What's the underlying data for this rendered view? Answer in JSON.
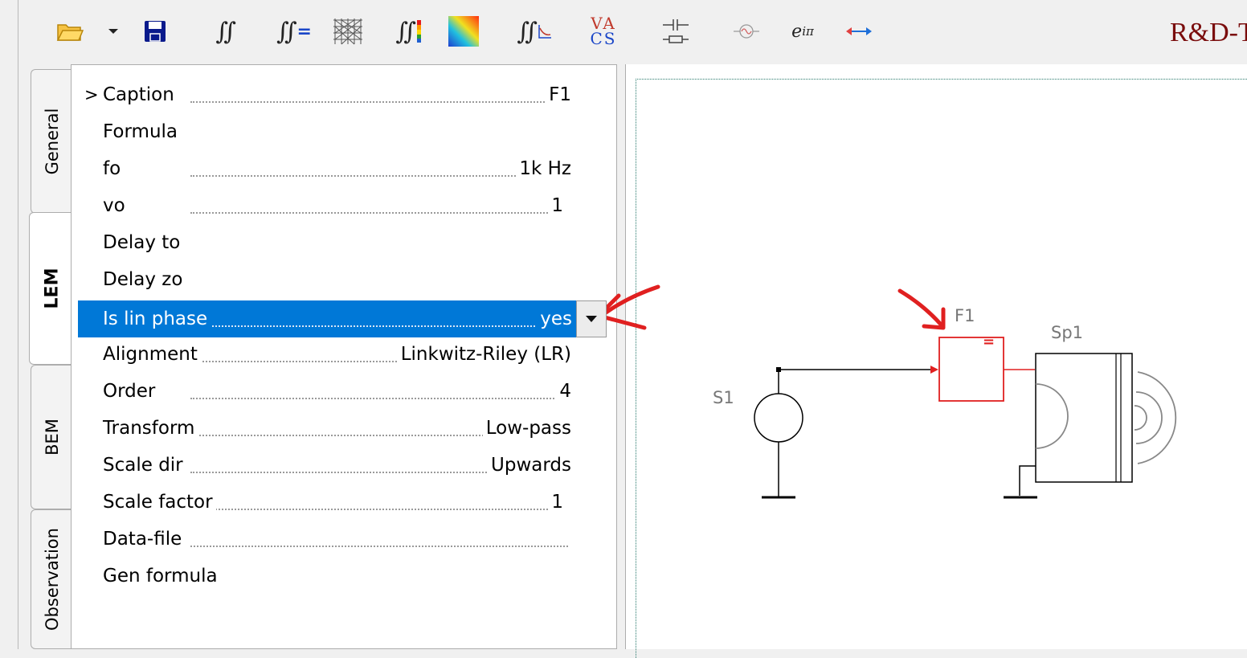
{
  "toolbar": {
    "icons": [
      "folder-open-icon",
      "dropdown-arrow-icon",
      "save-icon",
      "double-integral-icon",
      "integral-equals-icon",
      "mesh-grid-icon",
      "integral-color-bars-icon",
      "color-gradient-icon",
      "integral-graph-icon",
      "vacs-icon",
      "capacitor-resistor-icon",
      "sine-source-icon",
      "exponential-icon",
      "double-arrow-icon"
    ],
    "vacs_top": "VA",
    "vacs_bottom": "CS",
    "exp_label": "e",
    "exp_sup": "iπ",
    "brand": "R&D-T"
  },
  "tabs": [
    {
      "label": "General",
      "active": false
    },
    {
      "label": "LEM",
      "active": true
    },
    {
      "label": "BEM",
      "active": false
    },
    {
      "label": "Observation",
      "active": false
    }
  ],
  "properties": {
    "rows": [
      {
        "name": "Caption",
        "value": "F1",
        "cursor": ">"
      },
      {
        "name": "Formula",
        "value": ""
      },
      {
        "name": "fo",
        "value": "1k Hz"
      },
      {
        "name": "vo",
        "value": "1"
      },
      {
        "name": "Delay to",
        "value": ""
      },
      {
        "name": "Delay zo",
        "value": ""
      },
      {
        "name": "Is lin phase",
        "value": "yes",
        "selected": true
      },
      {
        "name": "Alignment",
        "value": "Linkwitz-Riley (LR)"
      },
      {
        "name": "Order",
        "value": "4"
      },
      {
        "name": "Transform",
        "value": "Low-pass"
      },
      {
        "name": "Scale dir",
        "value": "Upwards"
      },
      {
        "name": "Scale factor",
        "value": "1"
      },
      {
        "name": "Data-file",
        "value": ""
      },
      {
        "name": "Gen formula",
        "value": ""
      }
    ]
  },
  "schematic": {
    "source_label": "S1",
    "filter_label": "F1",
    "filter_symbol": "=",
    "speaker_label": "Sp1"
  },
  "colors": {
    "selection": "#0078d7",
    "annotation": "#e02020",
    "brand": "#7a0d0d",
    "filter": "#e02020"
  }
}
